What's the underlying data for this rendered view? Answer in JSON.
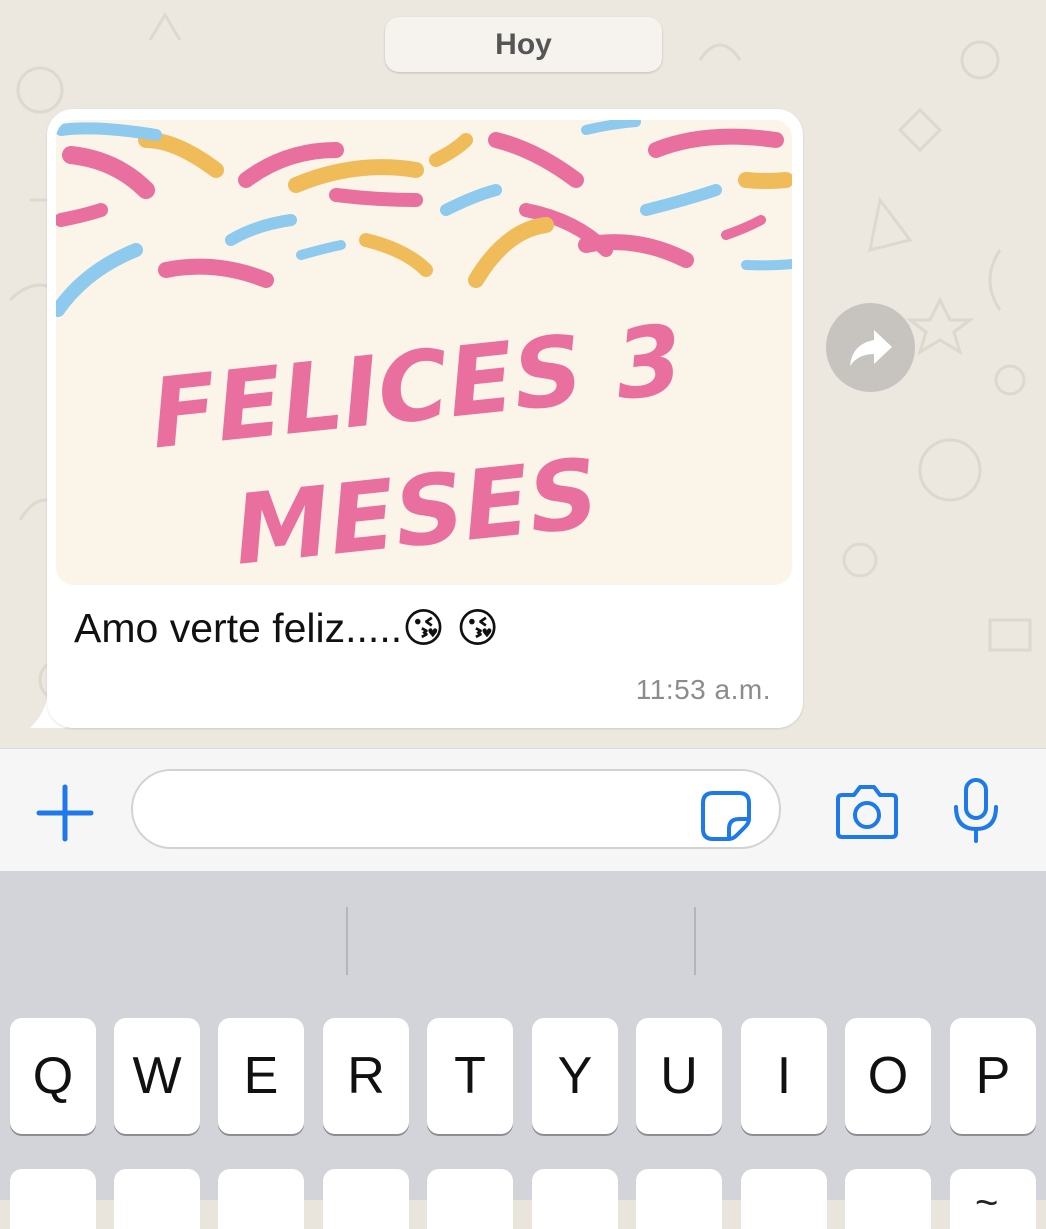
{
  "chat": {
    "date_label": "Hoy",
    "message": {
      "image_text_line1": "FELICES 3",
      "image_text_line2": "MESES",
      "text": "Amo verte feliz.....😘 😘",
      "time": "11:53 a.m."
    },
    "forward_icon": "forward-arrow-icon"
  },
  "input_bar": {
    "add_icon": "plus-icon",
    "text_value": "",
    "sticker_icon": "sticker-icon",
    "camera_icon": "camera-icon",
    "mic_icon": "microphone-icon"
  },
  "keyboard": {
    "row1": [
      "Q",
      "W",
      "E",
      "R",
      "T",
      "Y",
      "U",
      "I",
      "O",
      "P"
    ],
    "partial_key_mark": "~"
  },
  "colors": {
    "accent_blue": "#1d7ae8",
    "chat_bg": "#ece7df",
    "bubble_bg": "#ffffff",
    "keyboard_bg": "#d2d4da",
    "image_pink": "#e86f9e",
    "image_yellow": "#f0bc5a",
    "image_blue": "#8ec9ee"
  }
}
